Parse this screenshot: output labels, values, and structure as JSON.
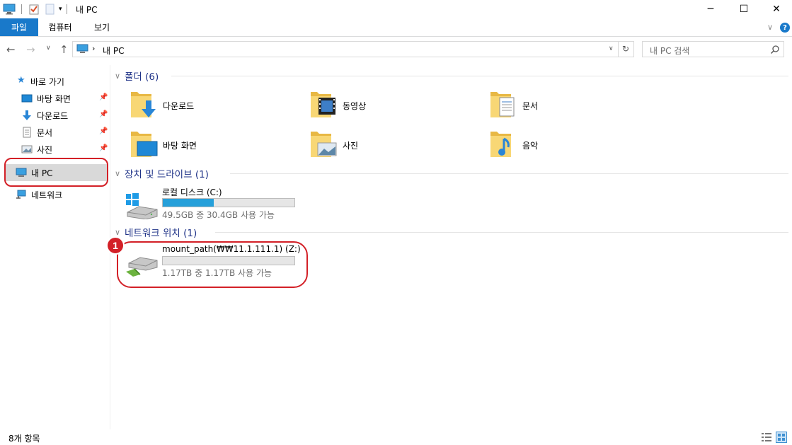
{
  "window": {
    "title": "내 PC",
    "icons": [
      "computer-icon",
      "properties-icon",
      "new-folder-icon",
      "customize-qa-icon"
    ],
    "controls": {
      "minimize": "─",
      "maximize": "☐",
      "close": "✕"
    }
  },
  "ribbon": {
    "tabs": [
      {
        "label": "파일",
        "active": true
      },
      {
        "label": "컴퓨터",
        "active": false
      },
      {
        "label": "보기",
        "active": false
      }
    ],
    "accent_color": "#1979ca"
  },
  "address": {
    "breadcrumb": "내 PC",
    "search_placeholder": "내 PC 검색"
  },
  "nav": {
    "quick_access_label": "바로 가기",
    "quick_items": [
      {
        "label": "바탕 화면",
        "icon": "desktop-icon"
      },
      {
        "label": "다운로드",
        "icon": "download-icon"
      },
      {
        "label": "문서",
        "icon": "document-icon"
      },
      {
        "label": "사진",
        "icon": "picture-icon"
      }
    ],
    "this_pc_label": "내 PC",
    "network_label": "네트워크"
  },
  "groups": {
    "folders_header": "폴더 (6)",
    "folders": [
      {
        "label": "다운로드",
        "icon": "downloads-folder-icon"
      },
      {
        "label": "동영상",
        "icon": "videos-folder-icon"
      },
      {
        "label": "문서",
        "icon": "documents-folder-icon"
      },
      {
        "label": "바탕 화면",
        "icon": "desktop-folder-icon"
      },
      {
        "label": "사진",
        "icon": "pictures-folder-icon"
      },
      {
        "label": "음악",
        "icon": "music-folder-icon"
      }
    ],
    "devices_header": "장치 및 드라이브 (1)",
    "local_disk": {
      "name": "로컬 디스크 (C:)",
      "usage": "49.5GB 중 30.4GB 사용 가능",
      "used_fraction": 0.386
    },
    "network_header": "네트워크 위치 (1)",
    "network_drive": {
      "name": "mount_path(₩₩11.1.111.1) (Z:)",
      "usage": "1.17TB 중 1.17TB 사용 가능",
      "used_fraction": 0.0
    }
  },
  "annotation": {
    "badge": "1",
    "color": "#d32027"
  },
  "status": {
    "item_count": "8개 항목"
  }
}
